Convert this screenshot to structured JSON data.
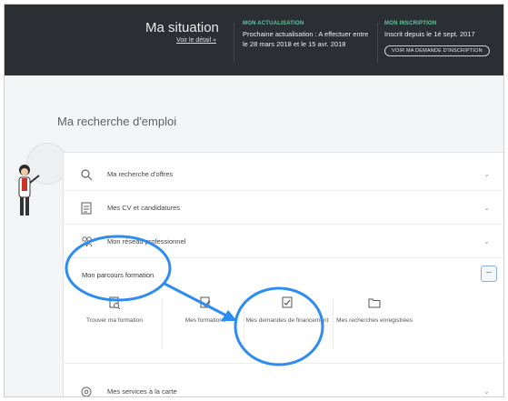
{
  "header": {
    "title": "Ma situation",
    "detail_link": "Voir le détail »",
    "actualisation": {
      "label": "MON ACTUALISATION",
      "text": "Prochaine actualisation : A effectuer entre le 28 mars 2018 et le 15 avr. 2018"
    },
    "inscription": {
      "label": "MON INSCRIPTION",
      "text": "Inscrit depuis le 1é sept. 2017",
      "button": "VOIR MA DEMANDE D'INSCRIPTION"
    }
  },
  "section": {
    "title": "Ma recherche d'emploi"
  },
  "rows": [
    {
      "label": "Ma recherche d'offres",
      "icon": "search-icon"
    },
    {
      "label": "Mes CV et candidatures",
      "icon": "document-icon"
    },
    {
      "label": "Mon réseau professionnel",
      "icon": "people-icon"
    }
  ],
  "formation": {
    "title": "Mon parcours formation",
    "collapse_symbol": "−",
    "tiles": [
      {
        "label": "Trouver ma formation",
        "icon": "search-doc-icon"
      },
      {
        "label": "Mes formations",
        "icon": "doc-edit-icon"
      },
      {
        "label": "Mes demandes de financement",
        "icon": "doc-check-icon"
      },
      {
        "label": "Mes recherches enregistrées",
        "icon": "folder-icon"
      }
    ]
  },
  "last_row": {
    "label": "Mes services à la carte",
    "icon": "tools-icon"
  },
  "chevron": "⌄",
  "colors": {
    "header_bg": "#2b2e33",
    "accent_green": "#5fc8a0",
    "annotation_blue": "#2d8cf0"
  }
}
